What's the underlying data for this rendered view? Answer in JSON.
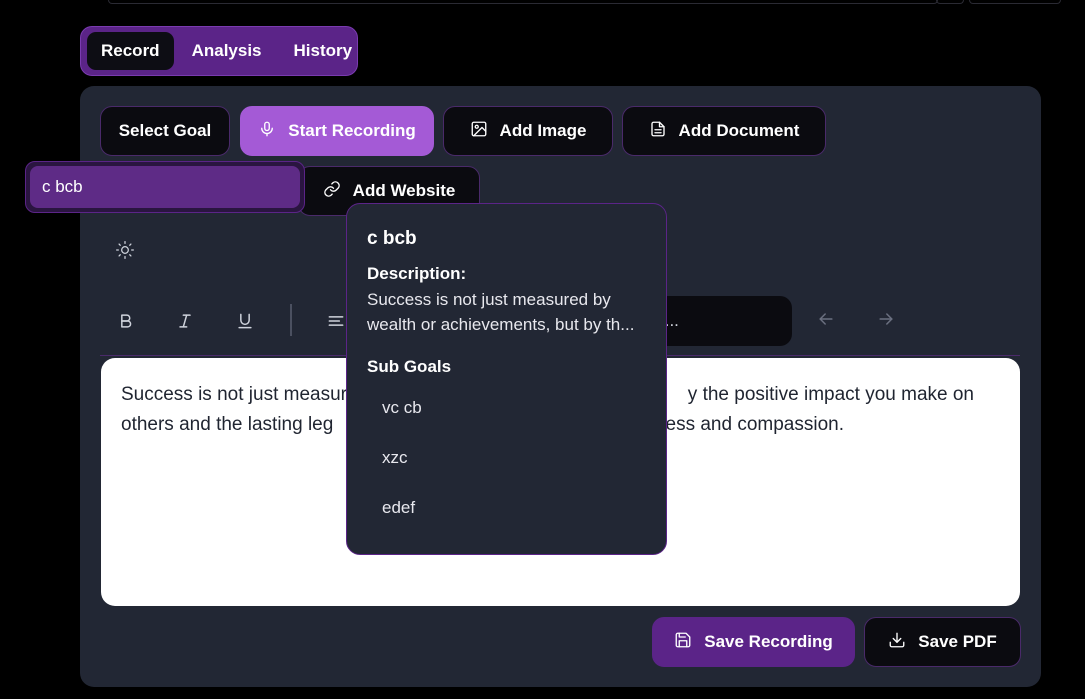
{
  "tabs": [
    {
      "label": "Record",
      "active": true
    },
    {
      "label": "Analysis",
      "active": false
    },
    {
      "label": "History",
      "active": false
    }
  ],
  "actions": {
    "select_goal": "Select Goal",
    "start_recording": "Start Recording",
    "add_image": "Add Image",
    "add_document": "Add Document",
    "add_website": "Add Website"
  },
  "goal_field": {
    "value": "c bcb"
  },
  "url_field": {
    "value_fragment": "t..."
  },
  "editor": {
    "line1_a": "Success is not just measur",
    "line1_b": "y the positive impact you make on",
    "line2_a": "others and the lasting leg",
    "line2_b": "ess and compassion."
  },
  "popup": {
    "title": "c bcb",
    "description_label": "Description:",
    "description": "Success is not just measured by wealth or achievements, but by th...",
    "sub_goals_label": "Sub Goals",
    "sub_goals": [
      "vc cb",
      "xzc",
      "edef"
    ]
  },
  "footer": {
    "save_recording": "Save Recording",
    "save_pdf": "Save PDF"
  },
  "colors": {
    "accent": "#a45ad6",
    "accent_dark": "#5b2488",
    "card_bg": "#222734",
    "page_bg": "#000000"
  }
}
